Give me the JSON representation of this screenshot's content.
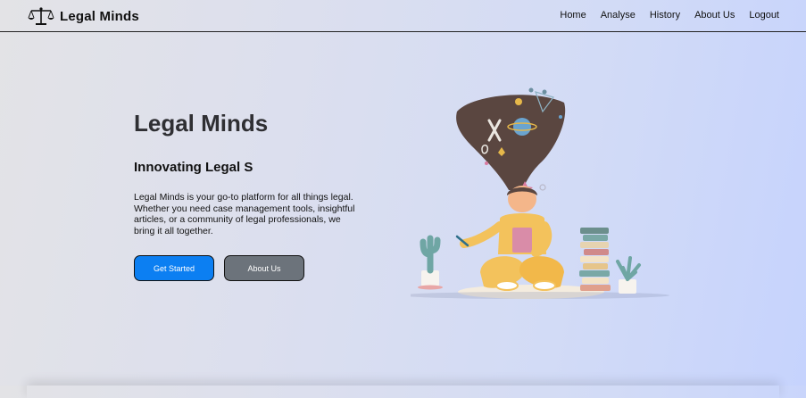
{
  "brand": {
    "name": "Legal Minds",
    "icon": "scales-icon"
  },
  "nav": {
    "items": [
      {
        "label": "Home"
      },
      {
        "label": "Analyse"
      },
      {
        "label": "History"
      },
      {
        "label": "About Us"
      },
      {
        "label": "Logout"
      }
    ]
  },
  "hero": {
    "title": "Legal Minds",
    "subtitle": "Innovating Legal S",
    "description": "Legal Minds is your go-to platform for all things legal. Whether you need case management tools, insightful articles, or a community of legal professionals, we bring it all together.",
    "primary_button": "Get Started",
    "secondary_button": "About Us"
  },
  "colors": {
    "primary_button": "#0c7ff2",
    "secondary_button": "#6c737b",
    "background_start": "#e3e3e6",
    "background_end": "#c6d3fd"
  }
}
